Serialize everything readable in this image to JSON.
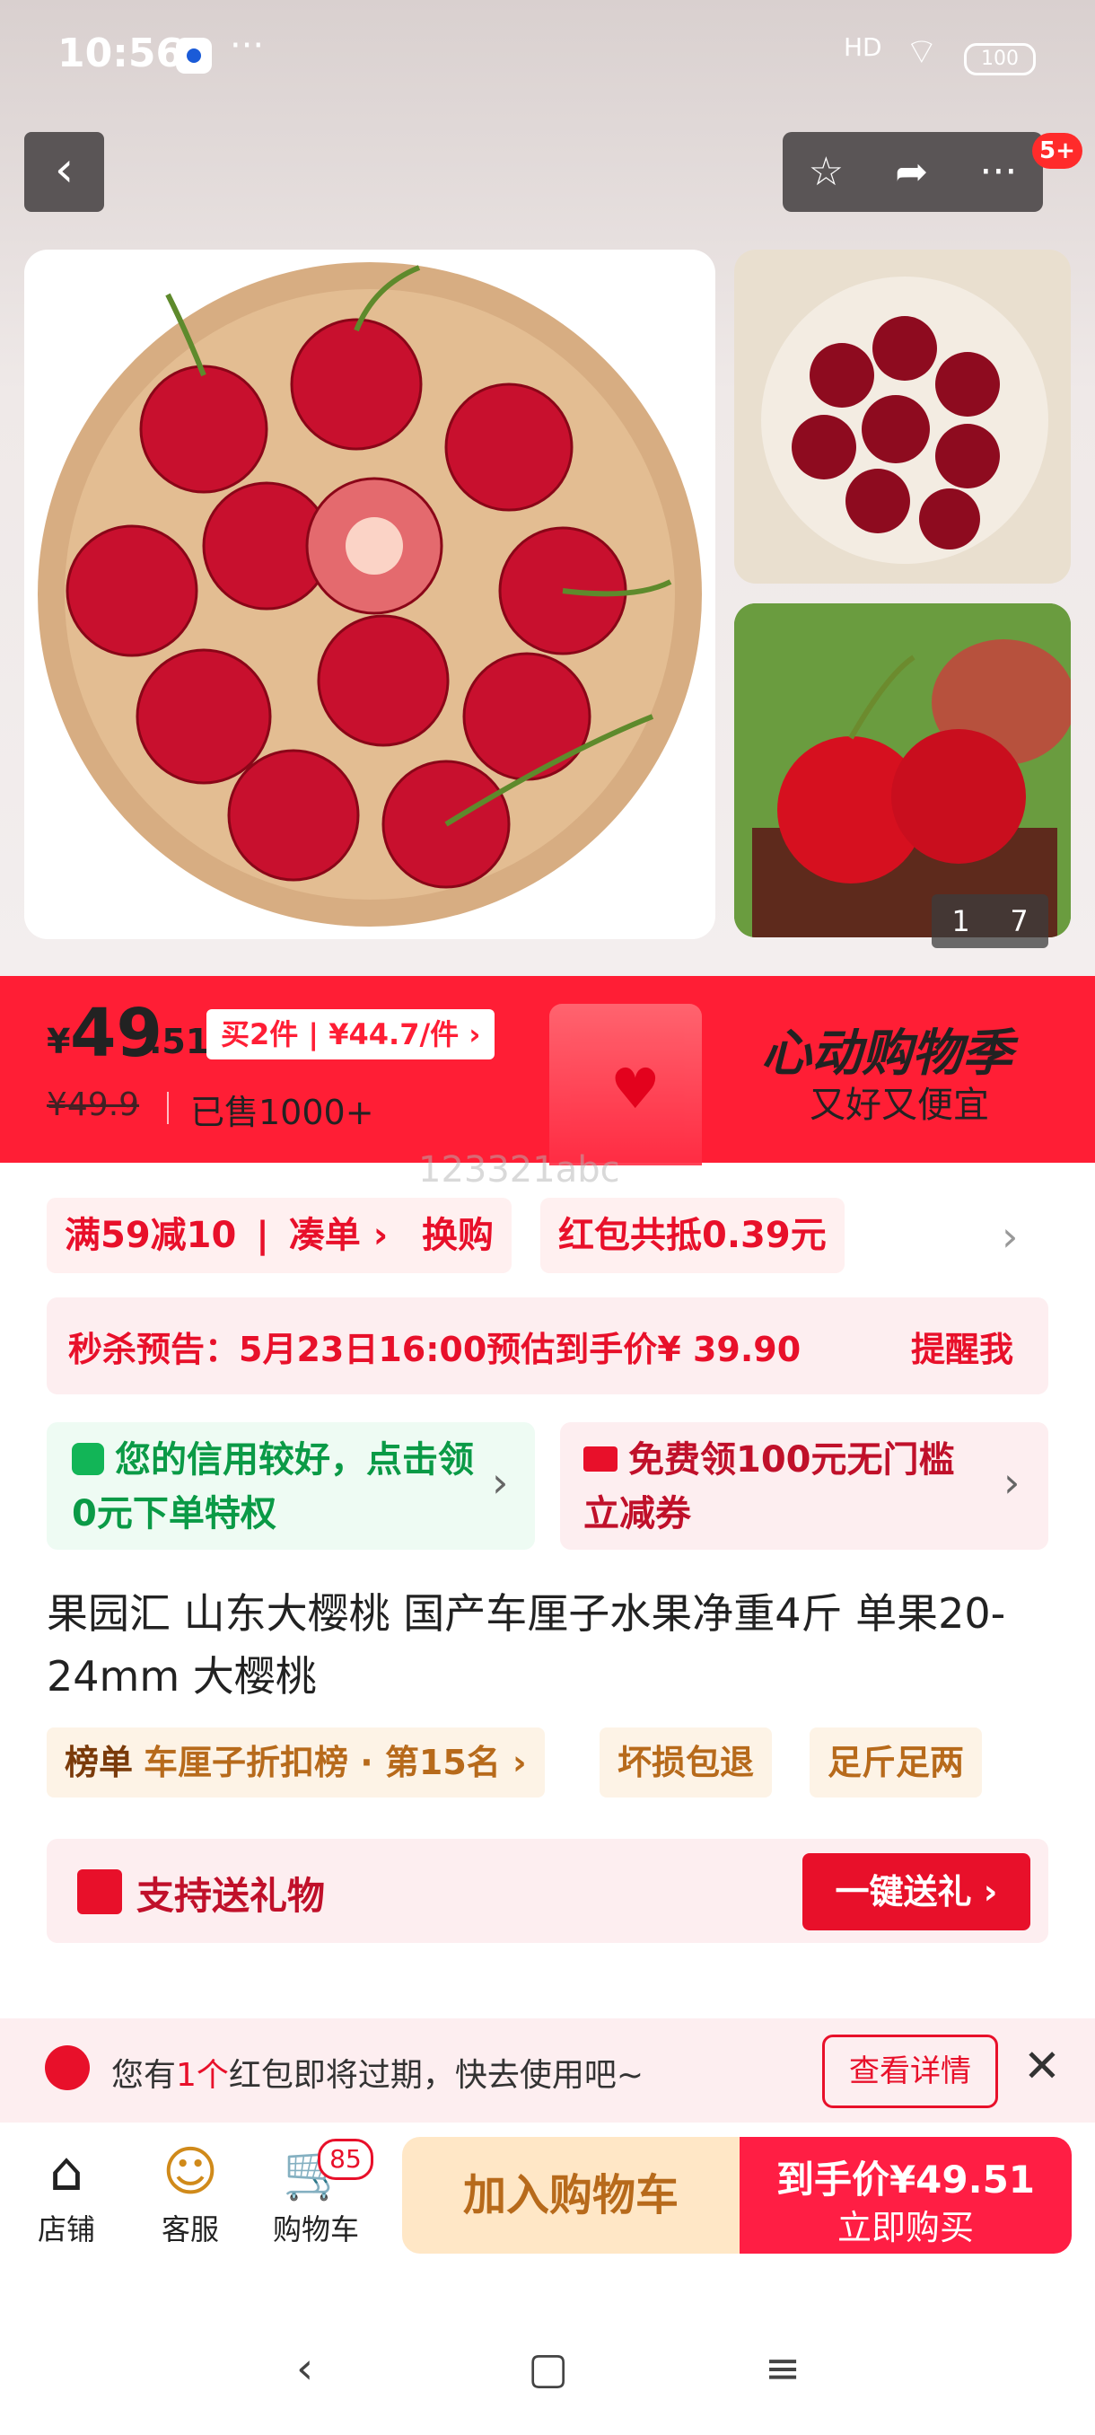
{
  "status_bar": {
    "time": "10:56",
    "dots": "···",
    "signal": "HD",
    "battery": "100"
  },
  "gallery": {
    "counter_current": "1",
    "counter_total": "7",
    "badge": "5+"
  },
  "price": {
    "symbol": "¥",
    "integer": "49",
    "decimal": ".51",
    "multi_buy": "买2件 | ¥44.7/件 ›",
    "original": "¥49.9",
    "sold": "已售1000+"
  },
  "promo": {
    "title": "心动购物季",
    "subtitle": "又好又便宜",
    "watermark": "123321abc"
  },
  "coupons": [
    {
      "label": "满59减10"
    },
    {
      "label": "凑单 ›"
    },
    {
      "label": "换购"
    },
    {
      "label": "红包共抵0.39元"
    }
  ],
  "seckill": {
    "text": "秒杀预告：5月23日16:00预估到手价¥ 39.90",
    "action": "提醒我"
  },
  "credit": {
    "text": "您的信用较好，点击领0元下单特权"
  },
  "coupon_card": {
    "text": "免费领100元无门槛立减券"
  },
  "product": {
    "title": "果园汇 山东大樱桃 国产车厘子水果净重4斤 单果20-24mm 大樱桃"
  },
  "tags": {
    "rank_label": "榜单",
    "rank_text": "车厘子折扣榜 · 第15名 ›",
    "tag2": "坏损包退",
    "tag3": "足斤足两"
  },
  "gift": {
    "label": "支持送礼物",
    "button": "一键送礼 ›"
  },
  "alert": {
    "prefix": "您有",
    "count": "1个",
    "suffix": "红包即将过期，快去使用吧~",
    "button": "查看详情"
  },
  "bottom": {
    "shop": "店铺",
    "service": "客服",
    "cart": "购物车",
    "cart_count": "85",
    "add_cart": "加入购物车",
    "buy_price": "到手价¥49.51",
    "buy_label": "立即购买"
  }
}
